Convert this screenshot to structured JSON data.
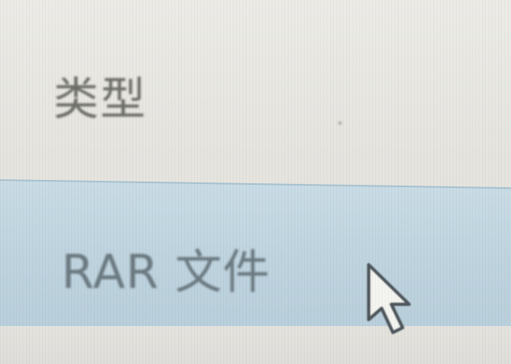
{
  "file_list": {
    "column_header": {
      "label": "类型"
    },
    "selected_row": {
      "type_label": "RAR 文件"
    }
  },
  "cursor": {
    "icon": "arrow-pointer-icon"
  },
  "colors": {
    "selection_bg": "#bfd4df",
    "header_text": "#6f6f6a",
    "row_text": "#6c7a82",
    "background": "#e7e6e1"
  }
}
